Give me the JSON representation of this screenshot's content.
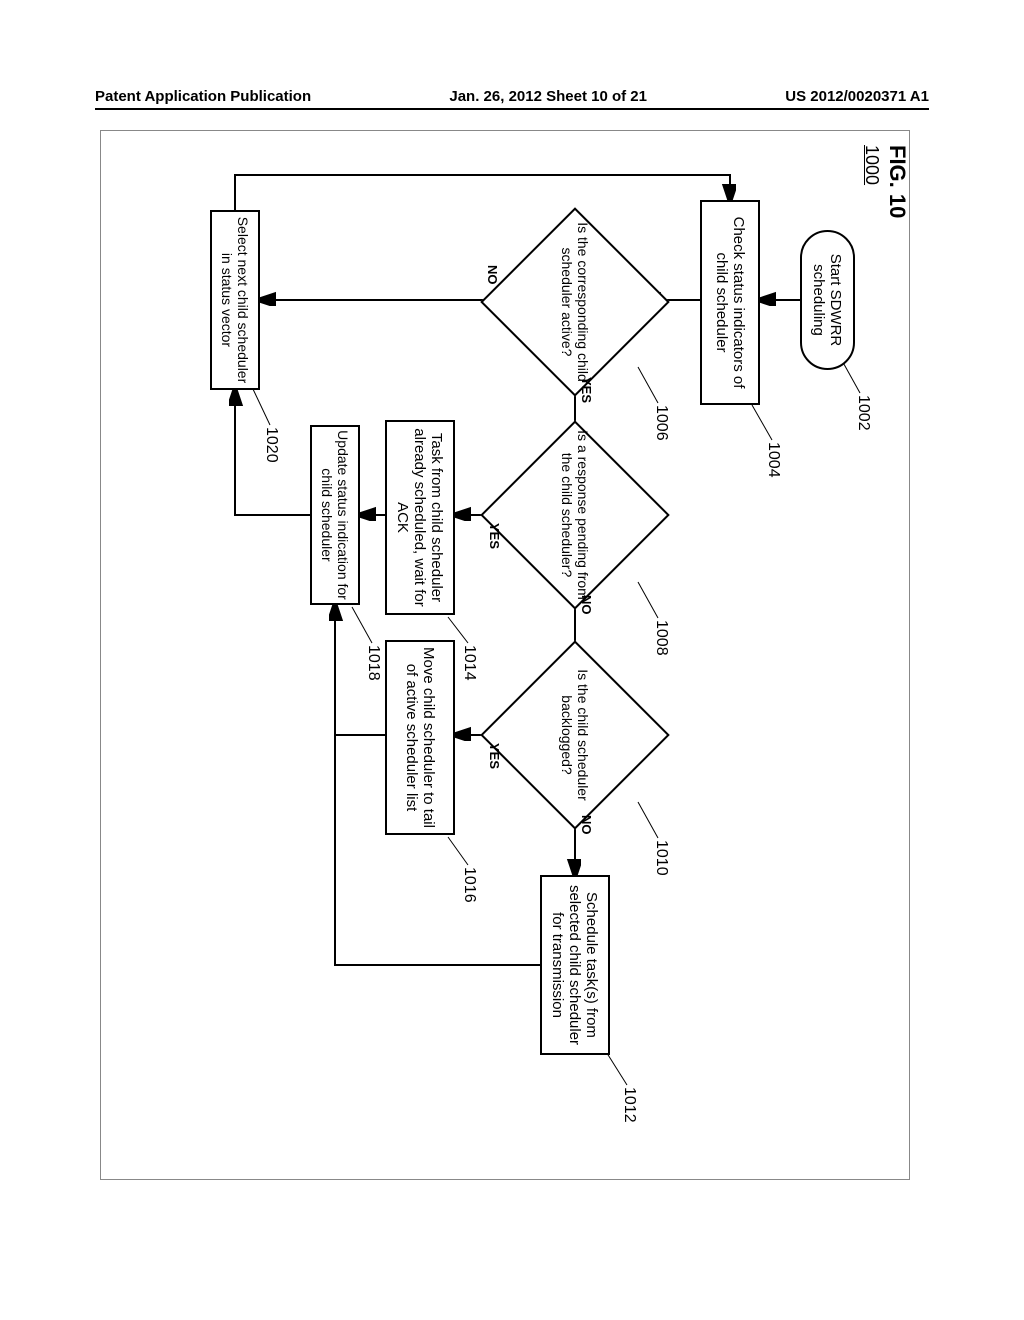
{
  "header": {
    "left": "Patent Application Publication",
    "center": "Jan. 26, 2012  Sheet 10 of 21",
    "right": "US 2012/0020371 A1"
  },
  "figure": {
    "label": "FIG. 10",
    "number": "1000"
  },
  "nodes": {
    "start": "Start SDWRR scheduling",
    "check": "Check status indicators of child scheduler",
    "d_active": "Is the corresponding child scheduler active?",
    "d_pending": "Is a response pending from the child scheduler?",
    "d_backlogged": "Is the child scheduler backlogged?",
    "schedule": "Schedule task(s) from selected child scheduler for transmission",
    "already": "Task from child scheduler already scheduled, wait for ACK",
    "move": "Move child scheduler to tail of active scheduler list",
    "update": "Update status indication for child scheduler",
    "selectnext": "Select next child scheduler in status vector"
  },
  "refs": {
    "r1002": "1002",
    "r1004": "1004",
    "r1006": "1006",
    "r1008": "1008",
    "r1010": "1010",
    "r1012": "1012",
    "r1014": "1014",
    "r1016": "1016",
    "r1018": "1018",
    "r1020": "1020"
  },
  "labels": {
    "yes": "YES",
    "no": "NO"
  },
  "chart_data": {
    "type": "flowchart",
    "title": "FIG. 10 - SDWRR Scheduling Flowchart (1000)",
    "nodes": [
      {
        "id": "1002",
        "type": "terminator",
        "text": "Start SDWRR scheduling"
      },
      {
        "id": "1004",
        "type": "process",
        "text": "Check status indicators of child scheduler"
      },
      {
        "id": "1006",
        "type": "decision",
        "text": "Is the corresponding child scheduler active?"
      },
      {
        "id": "1008",
        "type": "decision",
        "text": "Is a response pending from the child scheduler?"
      },
      {
        "id": "1010",
        "type": "decision",
        "text": "Is the child scheduler backlogged?"
      },
      {
        "id": "1012",
        "type": "process",
        "text": "Schedule task(s) from selected child scheduler for transmission"
      },
      {
        "id": "1014",
        "type": "process",
        "text": "Task from child scheduler already scheduled, wait for ACK"
      },
      {
        "id": "1016",
        "type": "process",
        "text": "Move child scheduler to tail of active scheduler list"
      },
      {
        "id": "1018",
        "type": "process",
        "text": "Update status indication for child scheduler"
      },
      {
        "id": "1020",
        "type": "process",
        "text": "Select next child scheduler in status vector"
      }
    ],
    "edges": [
      {
        "from": "1002",
        "to": "1004"
      },
      {
        "from": "1004",
        "to": "1006"
      },
      {
        "from": "1006",
        "to": "1008",
        "label": "YES"
      },
      {
        "from": "1006",
        "to": "1020",
        "label": "NO"
      },
      {
        "from": "1008",
        "to": "1010",
        "label": "NO"
      },
      {
        "from": "1008",
        "to": "1014",
        "label": "YES"
      },
      {
        "from": "1010",
        "to": "1012",
        "label": "NO"
      },
      {
        "from": "1010",
        "to": "1016",
        "label": "YES"
      },
      {
        "from": "1012",
        "to": "1018"
      },
      {
        "from": "1014",
        "to": "1018"
      },
      {
        "from": "1016",
        "to": "1018"
      },
      {
        "from": "1018",
        "to": "1020"
      },
      {
        "from": "1020",
        "to": "1004"
      }
    ]
  }
}
